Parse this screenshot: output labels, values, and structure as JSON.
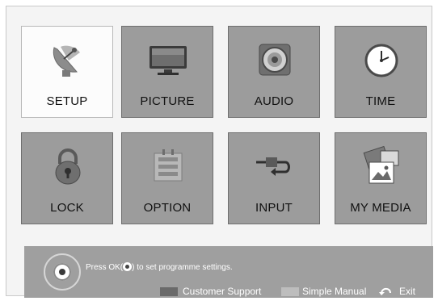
{
  "menu": {
    "tiles": [
      {
        "label": "SETUP",
        "icon": "satellite-dish-icon",
        "selected": true
      },
      {
        "label": "PICTURE",
        "icon": "tv-monitor-icon",
        "selected": false
      },
      {
        "label": "AUDIO",
        "icon": "speaker-icon",
        "selected": false
      },
      {
        "label": "TIME",
        "icon": "clock-icon",
        "selected": false
      },
      {
        "label": "LOCK",
        "icon": "padlock-icon",
        "selected": false
      },
      {
        "label": "OPTION",
        "icon": "option-box-icon",
        "selected": false
      },
      {
        "label": "INPUT",
        "icon": "input-plug-icon",
        "selected": false
      },
      {
        "label": "MY MEDIA",
        "icon": "photo-media-icon",
        "selected": false
      }
    ]
  },
  "footer": {
    "hint_prefix": "Press OK(",
    "hint_suffix": ") to set programme settings.",
    "customer_support": "Customer Support",
    "simple_manual": "Simple Manual",
    "exit": "Exit"
  },
  "colors": {
    "tile_bg": "#9c9c9c",
    "tile_selected_bg": "#fcfcfc",
    "footer_bg": "#9f9f9f",
    "customer_support_swatch": "#6a6a6a",
    "simple_manual_swatch": "#bdbdbd"
  }
}
